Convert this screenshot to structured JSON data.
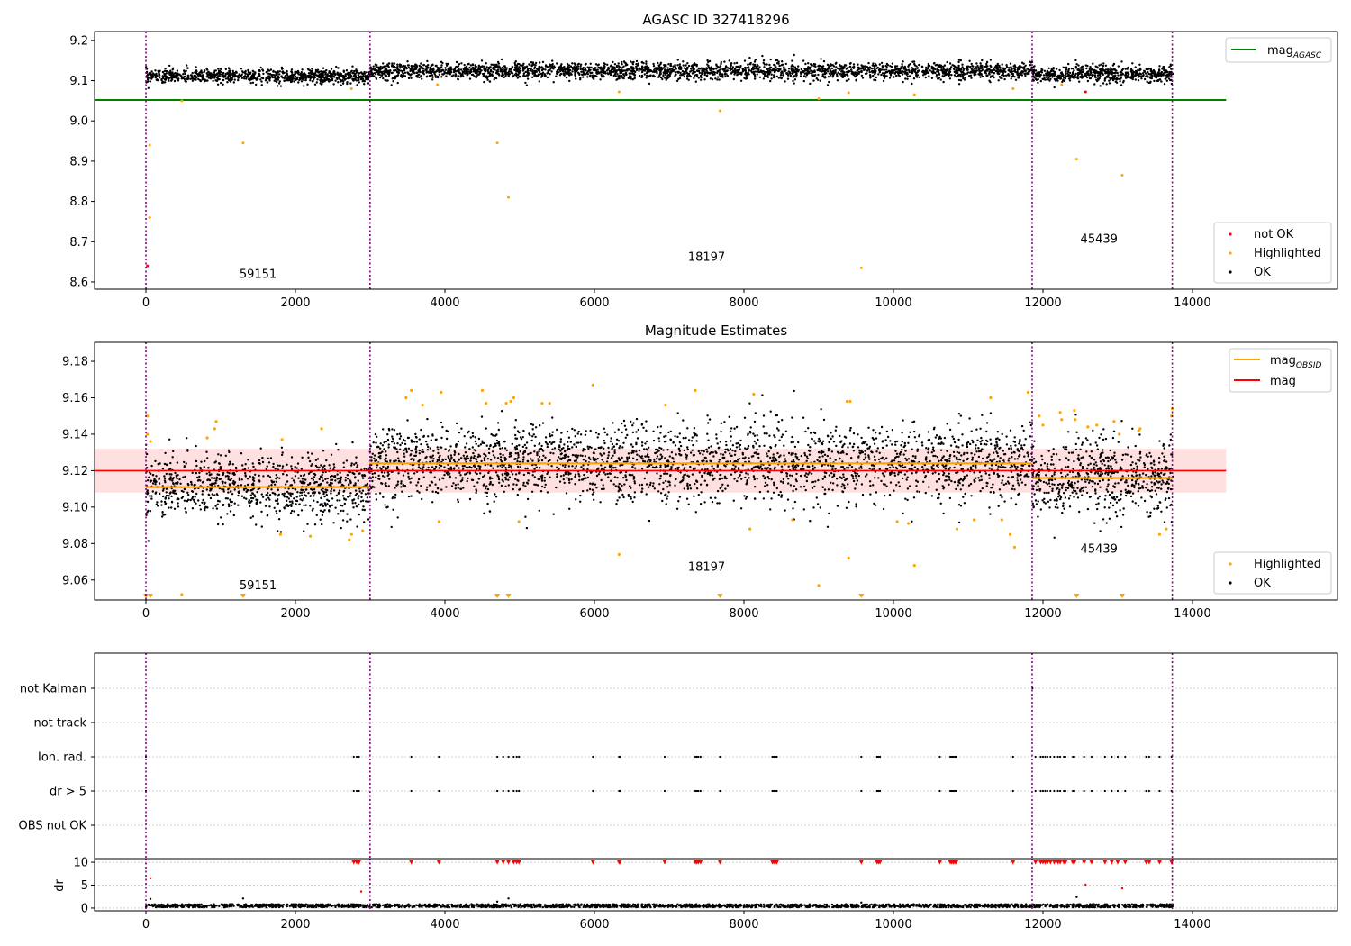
{
  "chart_data": [
    {
      "type": "scatter",
      "title": "AGASC ID 327418296",
      "xlim": [
        -687,
        15940
      ],
      "ylim": [
        8.582,
        9.222
      ],
      "xticks": [
        "0",
        "2000",
        "4000",
        "6000",
        "8000",
        "10000",
        "12000",
        "14000"
      ],
      "xtick_values": [
        0,
        2000,
        4000,
        6000,
        8000,
        10000,
        12000,
        14000
      ],
      "yticks": [
        "8.6",
        "8.7",
        "8.8",
        "8.9",
        "9.0",
        "9.1",
        "9.2"
      ],
      "ytick_values": [
        8.6,
        8.7,
        8.8,
        8.9,
        9.0,
        9.1,
        9.2
      ],
      "legend_top": {
        "position": "upper right",
        "entries": [
          {
            "main": "mag",
            "sub": "AGASC",
            "color": "#008000"
          }
        ]
      },
      "legend_bottom": {
        "position": "lower right",
        "entries": [
          {
            "label": "not OK",
            "color": "#ff0000"
          },
          {
            "label": "Highlighted",
            "color": "#ffa500"
          },
          {
            "label": "OK",
            "color": "#000000"
          }
        ]
      },
      "mag_agasc": 9.052,
      "obsid_labels": [
        {
          "text": "59151",
          "x": 1500,
          "y": 8.61
        },
        {
          "text": "18197",
          "x": 7500,
          "y": 8.652
        },
        {
          "text": "45439",
          "x": 12750,
          "y": 8.697
        }
      ],
      "highlighted": [
        [
          50,
          8.94
        ],
        [
          50,
          8.76
        ],
        [
          1300,
          8.945
        ],
        [
          4700,
          8.945
        ],
        [
          4850,
          8.81
        ],
        [
          7680,
          9.025
        ],
        [
          9570,
          8.635
        ],
        [
          12450,
          8.905
        ],
        [
          13060,
          8.865
        ],
        [
          480,
          9.05
        ],
        [
          9000,
          9.055
        ],
        [
          9400,
          9.07
        ],
        [
          10280,
          9.065
        ],
        [
          6330,
          9.072
        ],
        [
          2750,
          9.08
        ],
        [
          3900,
          9.09
        ],
        [
          11600,
          9.08
        ],
        [
          12250,
          9.09
        ]
      ],
      "not_ok": [
        [
          20,
          8.64
        ],
        [
          12570,
          9.072
        ]
      ]
    },
    {
      "type": "scatter",
      "title": "Magnitude Estimates",
      "xlim": [
        -687,
        15940
      ],
      "ylim": [
        9.049,
        9.1904
      ],
      "xticks": [
        "0",
        "2000",
        "4000",
        "6000",
        "8000",
        "10000",
        "12000",
        "14000"
      ],
      "xtick_values": [
        0,
        2000,
        4000,
        6000,
        8000,
        10000,
        12000,
        14000
      ],
      "yticks": [
        "9.06",
        "9.08",
        "9.10",
        "9.12",
        "9.14",
        "9.16",
        "9.18"
      ],
      "ytick_values": [
        9.06,
        9.08,
        9.1,
        9.12,
        9.14,
        9.16,
        9.18
      ],
      "legend_top": {
        "position": "upper right",
        "entries": [
          {
            "main": "mag",
            "sub": "OBSID",
            "color": "#ffa500"
          },
          {
            "main": "mag",
            "sub": "",
            "color": "#ff0000"
          }
        ]
      },
      "legend_bottom": {
        "position": "lower right",
        "entries": [
          {
            "label": "Highlighted",
            "color": "#ffa500"
          },
          {
            "label": "OK",
            "color": "#000000"
          }
        ]
      },
      "mag": 9.12,
      "mag_band": [
        9.108,
        9.132
      ],
      "mag_line_x": [
        -687,
        14450
      ],
      "segments": [
        {
          "obsid": "59151",
          "start": 0,
          "end": 2990,
          "mean": 9.111,
          "std": 0.0085,
          "n": 900
        },
        {
          "obsid": "18197",
          "start": 2990,
          "end": 11860,
          "mean": 9.124,
          "std": 0.0105,
          "n": 2600
        },
        {
          "obsid": "45439",
          "start": 11860,
          "end": 13740,
          "mean": 9.116,
          "std": 0.0105,
          "n": 600
        }
      ],
      "obsid_labels": [
        {
          "text": "59151",
          "x": 1500,
          "y": 9.055
        },
        {
          "text": "18197",
          "x": 7500,
          "y": 9.065
        },
        {
          "text": "45439",
          "x": 12750,
          "y": 9.075
        }
      ],
      "highlighted": [
        [
          20,
          9.15
        ],
        [
          20,
          9.14
        ],
        [
          60,
          9.136
        ],
        [
          480,
          9.052
        ],
        [
          940,
          9.147
        ],
        [
          920,
          9.143
        ],
        [
          820,
          9.138
        ],
        [
          1820,
          9.137
        ],
        [
          2350,
          9.143
        ],
        [
          2750,
          9.085
        ],
        [
          2720,
          9.082
        ],
        [
          2900,
          9.087
        ],
        [
          1800,
          9.085
        ],
        [
          2200,
          9.084
        ],
        [
          3480,
          9.16
        ],
        [
          3550,
          9.164
        ],
        [
          3700,
          9.156
        ],
        [
          3920,
          9.092
        ],
        [
          3950,
          9.163
        ],
        [
          4500,
          9.164
        ],
        [
          4550,
          9.157
        ],
        [
          4820,
          9.157
        ],
        [
          4880,
          9.158
        ],
        [
          4920,
          9.16
        ],
        [
          4990,
          9.092
        ],
        [
          5300,
          9.157
        ],
        [
          5400,
          9.157
        ],
        [
          5980,
          9.167
        ],
        [
          6330,
          9.074
        ],
        [
          6950,
          9.156
        ],
        [
          7350,
          9.164
        ],
        [
          8080,
          9.088
        ],
        [
          8130,
          9.162
        ],
        [
          8650,
          9.093
        ],
        [
          9000,
          9.057
        ],
        [
          9380,
          9.158
        ],
        [
          9420,
          9.158
        ],
        [
          9400,
          9.072
        ],
        [
          10050,
          9.092
        ],
        [
          10200,
          9.091
        ],
        [
          10280,
          9.068
        ],
        [
          10850,
          9.088
        ],
        [
          11080,
          9.093
        ],
        [
          11300,
          9.16
        ],
        [
          11450,
          9.093
        ],
        [
          11560,
          9.085
        ],
        [
          11620,
          9.078
        ],
        [
          11800,
          9.163
        ],
        [
          11950,
          9.15
        ],
        [
          12000,
          9.145
        ],
        [
          12230,
          9.152
        ],
        [
          12250,
          9.148
        ],
        [
          12420,
          9.153
        ],
        [
          12430,
          9.148
        ],
        [
          12600,
          9.144
        ],
        [
          12720,
          9.145
        ],
        [
          12950,
          9.147
        ],
        [
          13020,
          9.14
        ],
        [
          13300,
          9.143
        ],
        [
          13280,
          9.142
        ],
        [
          13560,
          9.085
        ],
        [
          13650,
          9.088
        ],
        [
          13720,
          9.15
        ],
        [
          13730,
          9.154
        ]
      ],
      "off_scale_low": [
        0,
        60,
        1300,
        4700,
        4850,
        7680,
        9570,
        12450,
        13060
      ]
    },
    {
      "type": "scatter",
      "title": "",
      "xlim": [
        -687,
        15940
      ],
      "categories": [
        "not Kalman",
        "not track",
        "Ion. rad.",
        "dr > 5",
        "OBS not OK"
      ],
      "flags": {
        "not Kalman": [
          11860
        ],
        "not track": [],
        "Ion. rad.": [
          0,
          2780,
          2820,
          2850,
          3550,
          3920,
          4700,
          4780,
          4850,
          4920,
          4960,
          4990,
          5980,
          6330,
          6340,
          6940,
          7350,
          7370,
          7390,
          7420,
          7680,
          8380,
          8400,
          8420,
          8440,
          9570,
          9780,
          9800,
          9820,
          10620,
          10760,
          10780,
          10800,
          10820,
          10840,
          11600,
          11900,
          11970,
          12000,
          12030,
          12060,
          12100,
          12150,
          12200,
          12230,
          12280,
          12300,
          12400,
          12420,
          12550,
          12650,
          12830,
          12920,
          13000,
          13100,
          13380,
          13420,
          13560,
          13720
        ],
        "dr > 5": [
          0,
          2780,
          2820,
          2850,
          3550,
          3920,
          4700,
          4780,
          4850,
          4920,
          4960,
          4990,
          5980,
          6330,
          6340,
          6940,
          7350,
          7370,
          7390,
          7420,
          7680,
          8380,
          8400,
          8420,
          8440,
          9570,
          9780,
          9800,
          9820,
          10620,
          10760,
          10780,
          10800,
          10820,
          10840,
          11600,
          11900,
          11970,
          12000,
          12030,
          12060,
          12100,
          12150,
          12200,
          12230,
          12280,
          12300,
          12400,
          12420,
          12550,
          12650,
          12830,
          12920,
          13000,
          13100,
          13380,
          13420,
          13560,
          13720
        ],
        "OBS not OK": []
      }
    },
    {
      "type": "scatter",
      "ylabel": "dr",
      "xlim": [
        -687,
        15940
      ],
      "ylim": [
        -0.6,
        10.8
      ],
      "xticks": [
        "0",
        "2000",
        "4000",
        "6000",
        "8000",
        "10000",
        "12000",
        "14000"
      ],
      "xtick_values": [
        0,
        2000,
        4000,
        6000,
        8000,
        10000,
        12000,
        14000
      ],
      "yticks": [
        "0",
        "5",
        "10"
      ],
      "ytick_values": [
        0,
        5,
        10
      ],
      "dr_clip": 10,
      "dr_typical": [
        0.1,
        0.9
      ],
      "dr_outliers": [
        [
          60,
          6.5
        ],
        [
          60,
          2
        ],
        [
          1300,
          2.1
        ],
        [
          2880,
          3.6
        ],
        [
          4700,
          1.4
        ],
        [
          4850,
          2.1
        ],
        [
          12450,
          2.4
        ],
        [
          12570,
          5.1
        ],
        [
          13060,
          4.3
        ],
        [
          9570,
          1.2
        ]
      ]
    }
  ],
  "obsid_boundaries": [
    0,
    2998,
    11855,
    13730
  ],
  "colors": {
    "ok": "#000000",
    "highlighted": "#ffa500",
    "not_ok": "#ff0000",
    "agasc": "#008000",
    "obsid_line": "#ffa500",
    "mag_line": "#ff0000",
    "boundary": "#800080",
    "band": "#ff0000"
  }
}
